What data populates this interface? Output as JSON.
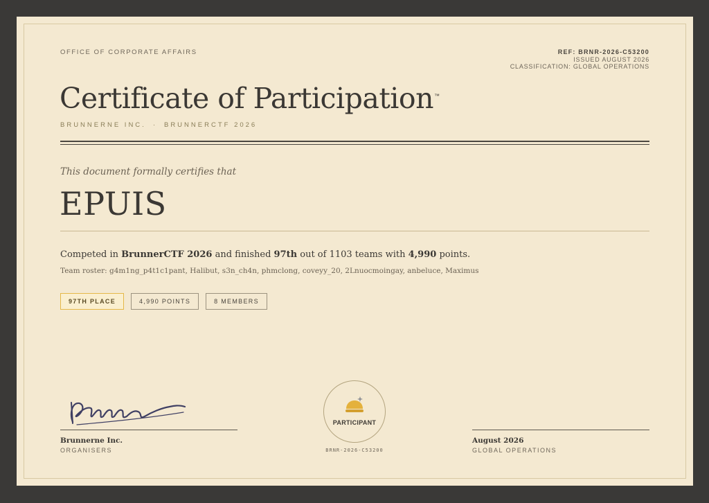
{
  "header": {
    "office": "OFFICE OF CORPORATE AFFAIRS",
    "ref": "REF: BRNR-2026-C53200",
    "issued": "ISSUED AUGUST 2026",
    "classification": "CLASSIFICATION: GLOBAL OPERATIONS"
  },
  "certificate": {
    "title": "Certificate of Participation",
    "trademark": "™",
    "org": "BRUNNERNE INC.",
    "separator": "·",
    "event": "BRUNNERCTF 2026",
    "certifies_text": "This document formally certifies that",
    "recipient": "EPUIS"
  },
  "summary": {
    "part1": "Competed in ",
    "ctf_name": "BrunnerCTF 2026",
    "part2": " and finished ",
    "place": "97th",
    "part3": " out of 1103 teams with ",
    "points": "4,990",
    "part4": " points.",
    "roster": "Team roster: g4m1ng_p4t1c1pant, Halibut, s3n_ch4n, phmclong, coveyy_20, 2Lnuocmoingay, anbeluce, Maximus"
  },
  "badges": {
    "place": "97TH PLACE",
    "points": "4,990 POINTS",
    "members": "8 MEMBERS"
  },
  "footer": {
    "left_name": "Brunnerne Inc.",
    "left_role": "ORGANISERS",
    "seal_label": "PARTICIPANT",
    "seal_ref": "BRNR-2026-C53200",
    "right_name": "August 2026",
    "right_role": "GLOBAL OPERATIONS"
  },
  "colors": {
    "paper": "#f4e9d1",
    "frame": "#3a3937",
    "gold": "#e4b848",
    "ink": "#3b3834"
  },
  "icons": {
    "seal": "bun-sparkle-icon"
  }
}
